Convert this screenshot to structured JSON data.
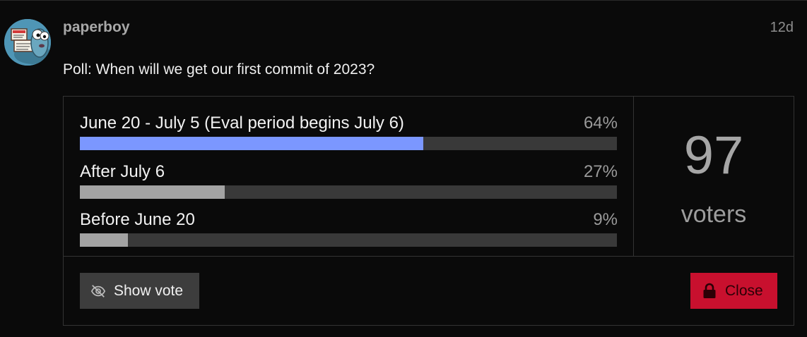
{
  "post": {
    "username": "paperboy",
    "timestamp": "12d",
    "question": "Poll: When will we get our first commit of 2023?"
  },
  "poll": {
    "options": [
      {
        "label": "June 20 - July 5 (Eval period begins July 6)",
        "percent_text": "64%",
        "percent": 64,
        "highlight": true
      },
      {
        "label": "After July 6",
        "percent_text": "27%",
        "percent": 27,
        "highlight": false
      },
      {
        "label": "Before June 20",
        "percent_text": "9%",
        "percent": 9,
        "highlight": false
      }
    ],
    "voters_count": "97",
    "voters_label": "voters",
    "show_vote_label": "Show vote",
    "close_label": "Close"
  },
  "icons": {
    "avatar": "avatar-image",
    "show_vote": "eye-slash-icon",
    "close": "lock-icon"
  },
  "colors": {
    "accent_bar": "#7b97ff",
    "secondary_bar": "#a3a3a3",
    "close_button": "#c8102e"
  }
}
